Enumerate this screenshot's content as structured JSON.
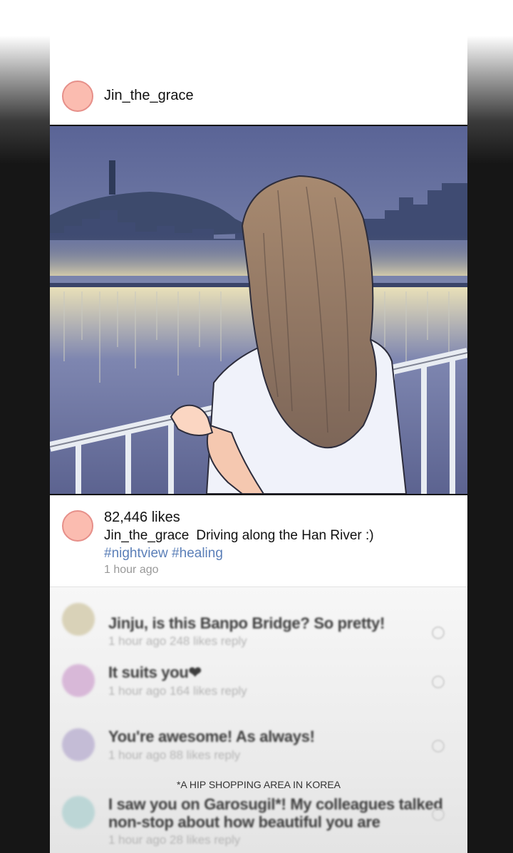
{
  "post": {
    "username": "Jin_the_grace",
    "likes": "82,446 likes",
    "caption_user": "Jin_the_grace",
    "caption_text": "Driving along the Han River :)",
    "hashtags": "#nightview #healing",
    "time": "1 hour ago"
  },
  "comments": [
    {
      "text": "Jinju, is this Banpo Bridge? So pretty!",
      "meta": "1 hour ago 248 likes reply",
      "avatar_color": "#d9d2b8"
    },
    {
      "text": "It suits you❤",
      "meta": "1 hour ago 164 likes reply",
      "avatar_color": "#d8b8d8"
    },
    {
      "text": "You're awesome! As always!",
      "meta": "1 hour ago 88 likes reply",
      "avatar_color": "#c4bcd6"
    },
    {
      "text": "I saw you on Garosugil*! My colleagues talked non-stop about how beautiful you are",
      "meta": "1 hour ago 28 likes reply",
      "avatar_color": "#bcd6d6"
    }
  ],
  "footnote": "*A HIP SHOPPING AREA IN KOREA",
  "colors": {
    "avatar_fill": "#fbbcb0",
    "hashtag": "#5b7fb8",
    "sky": "#5e6894"
  }
}
